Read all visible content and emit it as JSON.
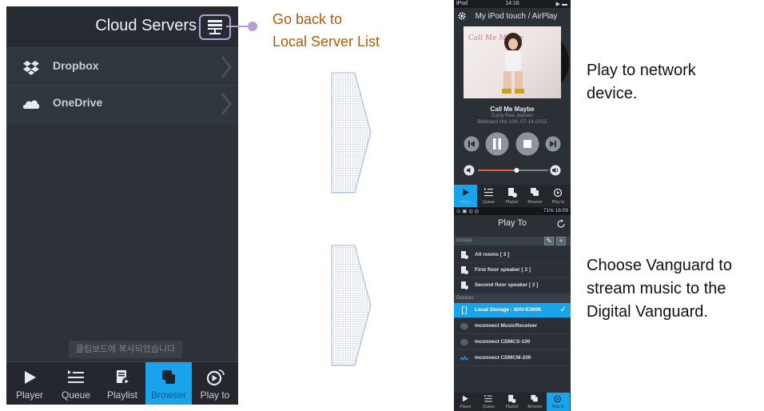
{
  "colors": {
    "accent": "#19a3ea",
    "note": "#b05a0e",
    "connector": "#b79ed6",
    "panel": "#2d323a"
  },
  "cloud_screen": {
    "title": "Cloud Servers",
    "back_icon": "server-list-icon",
    "items": [
      {
        "label": "Dropbox",
        "icon": "dropbox-icon"
      },
      {
        "label": "OneDrive",
        "icon": "cloud-icon"
      }
    ],
    "toast": "클립보드에 복사되었습니다",
    "tabs": [
      {
        "label": "Player",
        "icon": "play-icon",
        "active": false
      },
      {
        "label": "Queue",
        "icon": "queue-icon",
        "active": false
      },
      {
        "label": "Playlist",
        "icon": "playlist-icon",
        "active": false
      },
      {
        "label": "Browser",
        "icon": "browser-icon",
        "active": true
      },
      {
        "label": "Play to",
        "icon": "play-to-icon",
        "active": false
      }
    ]
  },
  "annotation": {
    "line1": "Go back to",
    "line2": "Local Server List"
  },
  "player_screen": {
    "status_left": "iPod",
    "status_time": "14:16",
    "title": "My iPod touch / AirPlay",
    "album_art_text": "Call Me Maybe",
    "song": "Call Me Maybe",
    "artist": "Carly Rae Jepsen",
    "chart": "Billboard Hot 100: 07-14-2012",
    "volume_level": 0.55,
    "tabs": [
      {
        "label": "Player",
        "active": true
      },
      {
        "label": "Queue",
        "active": false
      },
      {
        "label": "Playlist",
        "active": false
      },
      {
        "label": "Browser",
        "active": false
      },
      {
        "label": "Play to",
        "active": false
      }
    ]
  },
  "playto_screen": {
    "status_right": "71% 16:09",
    "title": "Play To",
    "groups_label": "Groups",
    "groups": [
      {
        "label": "All rooms [ 3 ]"
      },
      {
        "label": "First floor speaker [ 2 ]"
      },
      {
        "label": "Second floor speaker [ 2 ]"
      }
    ],
    "devices_label": "Devices",
    "devices": [
      {
        "label": "Local Storage : SHV-E300K",
        "selected": true
      },
      {
        "label": "mconnect MusicReceiver",
        "selected": false
      },
      {
        "label": "mconnect CDMCS-100",
        "selected": false
      },
      {
        "label": "mconnect CDMCM-200",
        "selected": false
      }
    ],
    "tabs": [
      {
        "label": "Player",
        "active": false
      },
      {
        "label": "Queue",
        "active": false
      },
      {
        "label": "Playlist",
        "active": false
      },
      {
        "label": "Browser",
        "active": false
      },
      {
        "label": "Play to",
        "active": true
      }
    ]
  },
  "captions": {
    "play_line1": "Play to network",
    "play_line2": "device.",
    "choose_line1": "Choose Vanguard to",
    "choose_line2": "stream music to the",
    "choose_line3": "Digital Vanguard."
  }
}
